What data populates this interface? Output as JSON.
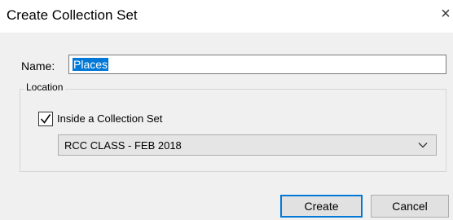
{
  "dialog": {
    "title": "Create Collection Set",
    "close_glyph": "×",
    "close_icon": "close-icon"
  },
  "name": {
    "label": "Name:",
    "value": "Places"
  },
  "location": {
    "legend": "Location",
    "inside_set_label": "Inside a Collection Set",
    "inside_set_checked": true,
    "selected_set": "RCC CLASS - FEB 2018",
    "dropdown_icon": "chevron-down-icon"
  },
  "buttons": {
    "create_label": "Create",
    "cancel_label": "Cancel"
  },
  "colors": {
    "selection": "#0078d7",
    "default_button_border": "#0078d7",
    "dialog_body": "#f0f0f0"
  }
}
